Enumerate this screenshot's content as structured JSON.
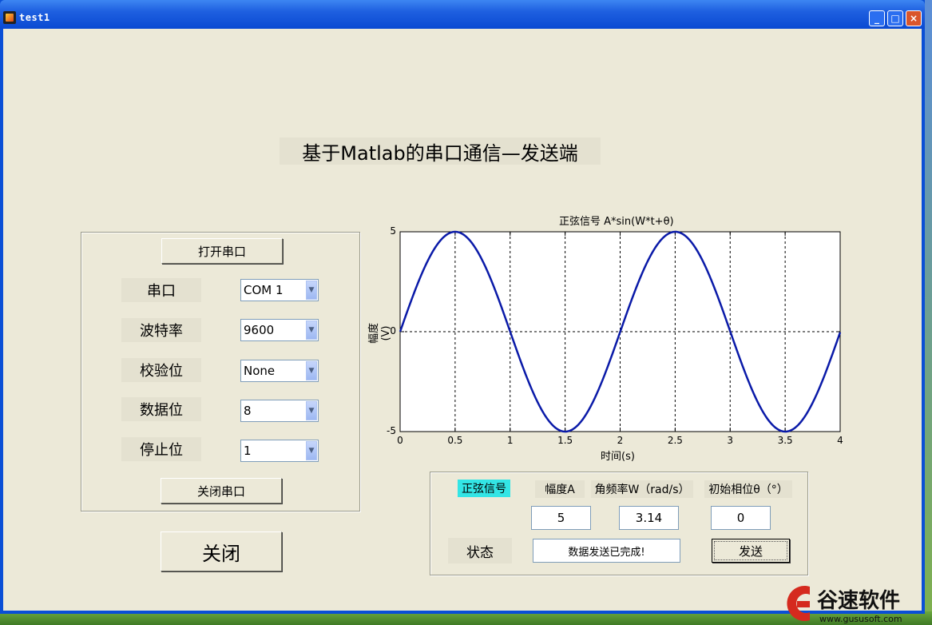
{
  "window": {
    "title": "test1",
    "buttons": {
      "minimize": "_",
      "maximize": "□",
      "close": "×"
    }
  },
  "main_title": "基于Matlab的串口通信—发送端",
  "serial_panel": {
    "open_button": "打开串口",
    "close_port_button": "关闭串口",
    "fields": [
      {
        "label": "串口",
        "value": "COM 1"
      },
      {
        "label": "波特率",
        "value": "9600"
      },
      {
        "label": "校验位",
        "value": "None"
      },
      {
        "label": "数据位",
        "value": "8"
      },
      {
        "label": "停止位",
        "value": "1"
      }
    ]
  },
  "close_button": "关闭",
  "signal_panel": {
    "signal_tag": "正弦信号",
    "amplitude_label": "幅度A",
    "freq_label": "角频率W（rad/s）",
    "phase_label": "初始相位θ（°）",
    "amplitude_value": "5",
    "freq_value": "3.14",
    "phase_value": "0",
    "status_label": "状态",
    "status_value": "数据发送已完成!",
    "send_button": "发送",
    "tag_color": "#33e5e5"
  },
  "chart_data": {
    "type": "line",
    "title": "正弦信号 A*sin(W*t+θ)",
    "xlabel": "时间(s)",
    "ylabel": "幅度(V)",
    "xlim": [
      0,
      4
    ],
    "ylim": [
      -5,
      5
    ],
    "xticks": [
      "0",
      "0.5",
      "1",
      "1.5",
      "2",
      "2.5",
      "3",
      "3.5",
      "4"
    ],
    "yticks": [
      "5",
      "0",
      "-5"
    ],
    "grid": true,
    "series": [
      {
        "function": "A*sin(W*t+θ)",
        "A": 5,
        "W": 3.14,
        "theta": 0,
        "color": "#0a1aa8"
      }
    ]
  },
  "watermark": {
    "text": "谷速软件",
    "url": "www.gususoft.com"
  }
}
